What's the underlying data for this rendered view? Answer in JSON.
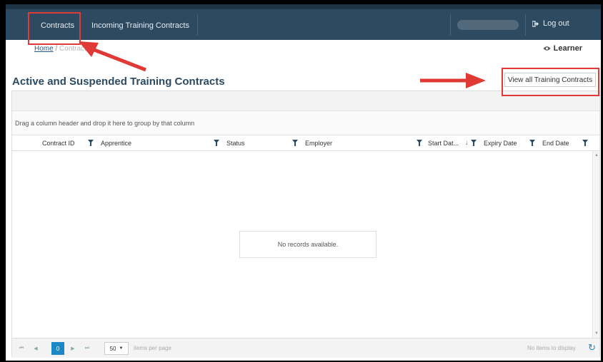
{
  "nav": {
    "contracts": "Contracts",
    "incoming": "Incoming Training Contracts",
    "logout": "Log out"
  },
  "breadcrumb": {
    "home": "Home",
    "separator": "/",
    "current": "Contracts"
  },
  "learner": "Learner",
  "page_title": "Active and Suspended Training Contracts",
  "view_all_button": "View all Training Contracts",
  "grid": {
    "group_hint": "Drag a column header and drop it here to group by that column",
    "columns": [
      "Contract ID",
      "Apprentice",
      "Status",
      "Employer",
      "Start Dat...",
      "Expiry Date",
      "End Date"
    ],
    "empty_message": "No records available.",
    "pager": {
      "current_page": "0",
      "page_size": "50",
      "items_per_page": "items per page",
      "info": "No items to display"
    }
  },
  "icons": {
    "logout": "sign-out-icon",
    "learner": "eye-icon",
    "filter": "filter-icon",
    "sort": "sort-desc-icon",
    "refresh": "refresh-icon"
  },
  "colors": {
    "nav_bg": "#2e4a60",
    "title": "#2b4a63",
    "accent": "#1e88c7",
    "annotation": "#e03a36"
  }
}
